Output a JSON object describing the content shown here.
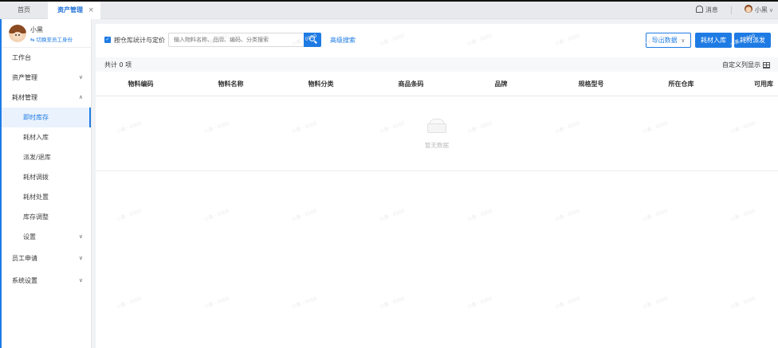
{
  "tabs": [
    {
      "label": "首页"
    },
    {
      "label": "资产管理",
      "close": "×"
    }
  ],
  "top_right": {
    "messages": "消息",
    "user": "小黑",
    "caret": "∨"
  },
  "sidebar": {
    "user_name": "小黑",
    "switch_identity": "⇆ 切换至员工身份",
    "items": [
      {
        "label": "工作台"
      },
      {
        "label": "资产管理",
        "arrow": "∨"
      },
      {
        "label": "耗材管理",
        "arrow": "∧"
      }
    ],
    "sub_items": [
      {
        "label": "即时库存"
      },
      {
        "label": "耗材入库"
      },
      {
        "label": "派发/退库"
      },
      {
        "label": "耗材调拨"
      },
      {
        "label": "耗材处置"
      },
      {
        "label": "库存调整"
      },
      {
        "label": "设置",
        "arrow": "∨"
      }
    ],
    "bottom_items": [
      {
        "label": "员工申请",
        "arrow": "∨"
      },
      {
        "label": "系统设置",
        "arrow": "∨"
      }
    ]
  },
  "toolbar": {
    "checkbox_label": "按仓库统计与定价",
    "search_placeholder": "输入物料名称、品牌、编码、分类搜索",
    "advanced_search": "高级搜索",
    "export": "导出数据",
    "export_caret": "∨",
    "stock_in": "耗材入库",
    "distribute": "耗材派发"
  },
  "summary": {
    "count": "共计 0 项",
    "custom_columns": "自定义列显示"
  },
  "table": {
    "columns": [
      "物料编码",
      "物料名称",
      "物料分类",
      "商品条码",
      "品牌",
      "规格型号",
      "所在仓库",
      "可用库"
    ],
    "empty_text": "暂无数据"
  },
  "colors": {
    "primary": "#1e7be4",
    "active_bg": "#e9f2fd"
  },
  "watermark": "小黑 · 0000"
}
